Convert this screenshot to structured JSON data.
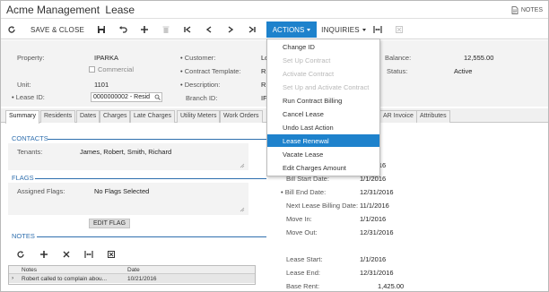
{
  "header": {
    "company": "Acme Management",
    "page": "Lease",
    "notes_label": "NOTES"
  },
  "toolbar": {
    "save_close": "SAVE & CLOSE",
    "actions": "ACTIONS",
    "inquiries": "INQUIRIES"
  },
  "form": {
    "property_label": "Property:",
    "property_value": "IPARKA",
    "commercial_label": "Commercial",
    "unit_label": "Unit:",
    "unit_value": "1101",
    "lease_id_label": "Lease ID:",
    "lease_id_value": "0000000002 - Resid",
    "customer_label": "Customer:",
    "customer_value": "Lo",
    "contract_template_label": "Contract Template:",
    "contract_template_value": "R",
    "description_label": "Description:",
    "description_value": "R",
    "branch_id_label": "Branch ID:",
    "branch_id_value": "IF",
    "balance_label": "Balance:",
    "balance_value": "12,555.00",
    "status_label": "Status:",
    "status_value": "Active"
  },
  "tabs": [
    {
      "label": "Summary",
      "active": true
    },
    {
      "label": "Residents"
    },
    {
      "label": "Dates"
    },
    {
      "label": "Charges"
    },
    {
      "label": "Late Charges"
    },
    {
      "label": "Utility Meters"
    },
    {
      "label": "Work Orders"
    },
    {
      "label": "AR Invoice"
    },
    {
      "label": "Attributes"
    }
  ],
  "contacts": {
    "heading": "CONTACTS",
    "tenants_label": "Tenants:",
    "tenants_value": "James, Robert, Smith, Richard"
  },
  "flags": {
    "heading": "FLAGS",
    "assigned_label": "Assigned Flags:",
    "assigned_value": "No Flags Selected",
    "edit_button": "EDIT FLAG"
  },
  "notes": {
    "heading": "NOTES",
    "columns": [
      "Notes",
      "Date"
    ],
    "rows": [
      {
        "note": "Robert called to complain abou...",
        "date": "10/21/2016"
      }
    ]
  },
  "dates": {
    "top_value": "1/1/2016",
    "bill_start_label": "Bill Start Date:",
    "bill_start_value": "1/1/2016",
    "bill_end_label": "Bill End Date:",
    "bill_end_value": "12/31/2016",
    "next_billing_label": "Next Lease Billing Date:",
    "next_billing_value": "11/1/2016",
    "move_in_label": "Move In:",
    "move_in_value": "1/1/2016",
    "move_out_label": "Move Out:",
    "move_out_value": "12/31/2016",
    "lease_start_label": "Lease Start:",
    "lease_start_value": "1/1/2016",
    "lease_end_label": "Lease End:",
    "lease_end_value": "12/31/2016",
    "base_rent_label": "Base Rent:",
    "base_rent_value": "1,425.00"
  },
  "actions_menu": [
    {
      "label": "Change ID",
      "enabled": true
    },
    {
      "label": "Set Up Contract",
      "enabled": false
    },
    {
      "label": "Activate Contract",
      "enabled": false
    },
    {
      "label": "Set Up and Activate Contract",
      "enabled": false
    },
    {
      "label": "Run Contract Billing",
      "enabled": true
    },
    {
      "label": "Cancel Lease",
      "enabled": true
    },
    {
      "label": "Undo Last Action",
      "enabled": true
    },
    {
      "label": "Lease Renewal",
      "enabled": true,
      "selected": true
    },
    {
      "label": "Vacate Lease",
      "enabled": true
    },
    {
      "label": "Edit Charges Amount",
      "enabled": true
    }
  ],
  "colors": {
    "accent": "#1e82cc",
    "section": "#2f6fae"
  }
}
